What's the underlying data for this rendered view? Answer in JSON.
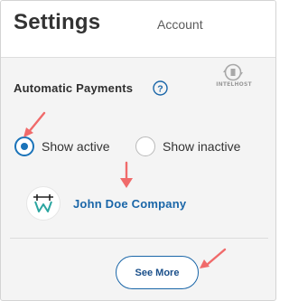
{
  "header": {
    "title": "Settings",
    "tab": "Account"
  },
  "automatic_payments": {
    "title": "Automatic Payments",
    "help_icon": "question-circle-icon",
    "watermark": "INTELHOST",
    "filter": {
      "options": [
        {
          "label": "Show active",
          "selected": true
        },
        {
          "label": "Show inactive",
          "selected": false
        }
      ]
    },
    "company": {
      "name": "John Doe Company",
      "logo_letters": "HW"
    },
    "see_more_label": "See More"
  },
  "colors": {
    "accent": "#1a73b9",
    "link": "#1a66a8",
    "annotation_arrow": "#f06a6a",
    "background": "#f4f4f4"
  }
}
